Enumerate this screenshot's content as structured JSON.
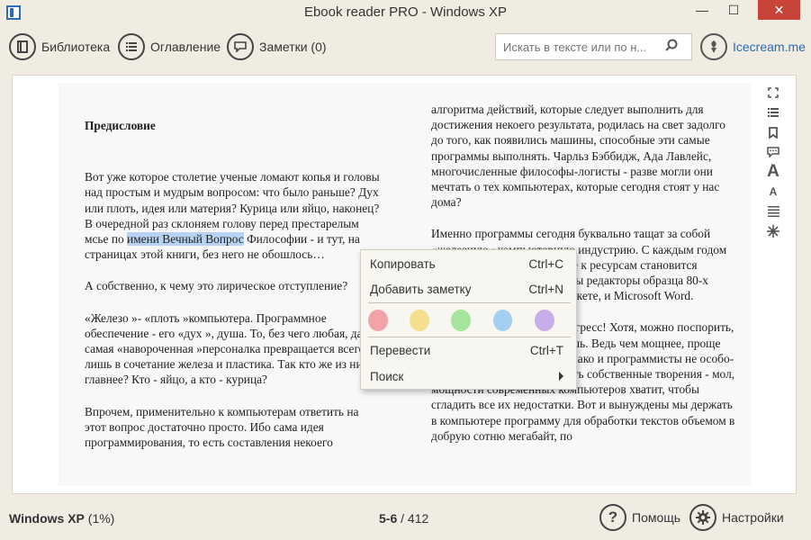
{
  "window": {
    "title": "Ebook reader PRO - Windows XP",
    "min_glyph": "—",
    "max_glyph": "☐",
    "close_glyph": "✕"
  },
  "toolbar": {
    "library_label": "Библиотека",
    "contents_label": "Оглавление",
    "notes_label": "Заметки (0)",
    "search_placeholder": "Искать в тексте или по н...",
    "brand": "Icecream.me"
  },
  "book": {
    "heading": "Предисловие",
    "p1_before": "Вот уже которое столетие ученые ломают копья и головы над простым и мудрым вопросом: что было раньше? Дух или плоть, идея или материя? Курица или яйцо, наконец? В очередной раз склоняем голову перед престарелым мсье по ",
    "p1_highlight": "имени Вечный Вопрос",
    "p1_after": " Философии - и тут, на страницах этой книги, без него не обошлось…",
    "p2": "А собственно, к чему это лирическое отступление?",
    "p3": "«Железо »- «плоть »компьютера. Программное обеспечение - его «дух », душа. То, без чего любая, даже самая «навороченная »персоналка превращается всего лишь в сочетание железа и пластика. Так кто же из них главнее? Кто - яйцо, а кто - курица?",
    "p4": "Впрочем, применительно к компьютерам ответить на этот вопрос достаточно просто. Ибо сама идея программирования, то есть составления некоего",
    "r1": "алгоритма действий, которые следует выполнить для достижения некоего результата, родилась на свет задолго до того, как появились машины, способные эти самые программы выполнять. Чарльз Бэббидж, Ада Лавлейс, многочисленные философы-логисты - разве могли они мечтать о тех компьютерах, которые сегодня стоят у нас дома?",
    "r2": "Именно программы сегодня буквально тащат за собой «железную »компьютерную индустрию. С каждым годом всё сложнее, требовательнее к ресурсам становится программа. Сравните хотя бы редакторы образца 80-х годов, умещающийся на дискете, и Microsoft Word.",
    "r3": "Хорошо это или плохо - прогресс! Хотя, можно поспорить, прогрессом это и не назовешь. Ведь чем мощнее, проще программа - тем лучше. Однако и программисты не особо-то стараются оптимизировать собственные творения - мол, мощности современных компьютеров хватит, чтобы сгладить все их недостатки. Вот и вынуждены мы держать в компьютере программу для обработки текстов объемом в добрую сотню мегабайт, по"
  },
  "context_menu": {
    "copy_label": "Копировать",
    "copy_shortcut": "Ctrl+C",
    "add_note_label": "Добавить заметку",
    "add_note_shortcut": "Ctrl+N",
    "colors": [
      "#f2a3a8",
      "#f5df8f",
      "#a6e39b",
      "#a3cff0",
      "#c8aee8"
    ],
    "translate_label": "Перевести",
    "translate_shortcut": "Ctrl+T",
    "search_label": "Поиск"
  },
  "strip_icons": [
    "fullscreen-icon",
    "list-icon",
    "bookmark-icon",
    "comment-icon",
    "font-increase-icon",
    "font-decrease-icon",
    "align-justify-icon",
    "brightness-icon"
  ],
  "status": {
    "book_title": "Windows XP",
    "book_progress": "(1%)",
    "page_current": "5-6",
    "page_total": "/ 412",
    "help_label": "Помощь",
    "settings_label": "Настройки"
  },
  "colors": {
    "accent": "#2a6bb8",
    "close_red": "#c7443a",
    "highlight": "#b8d2f2"
  }
}
